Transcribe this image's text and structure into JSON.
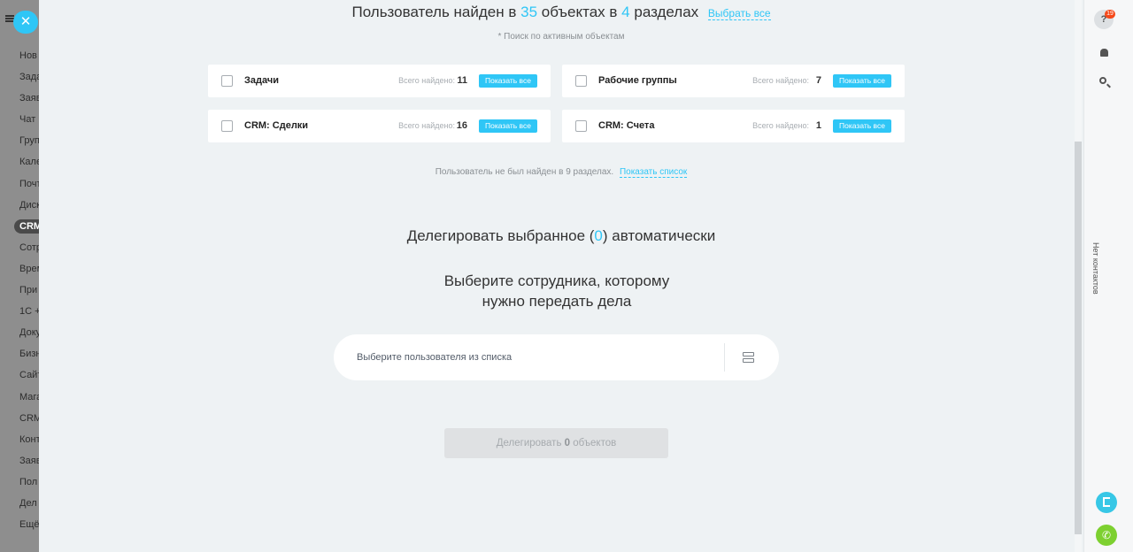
{
  "sidebar": {
    "items": [
      {
        "label": "Нов"
      },
      {
        "label": "Зада"
      },
      {
        "label": "Заяв"
      },
      {
        "label": "Чат"
      },
      {
        "label": "Груп"
      },
      {
        "label": "Кале"
      },
      {
        "label": "Почт"
      },
      {
        "label": "Диск"
      },
      {
        "label": "CRM",
        "active": true
      },
      {
        "label": "Сотр"
      },
      {
        "label": "Врем"
      },
      {
        "label": "При"
      },
      {
        "label": "1С +"
      },
      {
        "label": "Доку"
      },
      {
        "label": "Бизн"
      },
      {
        "label": "Сайт"
      },
      {
        "label": "Мага"
      },
      {
        "label": "CRM"
      },
      {
        "label": "Конт"
      },
      {
        "label": "Заяв"
      },
      {
        "label": "Пол"
      },
      {
        "label": "Дел"
      },
      {
        "label": "Ещё"
      }
    ]
  },
  "close_button": {
    "icon": "close-icon",
    "glyph": "✕"
  },
  "header": {
    "prefix": "Пользователь найден в",
    "objects_count": "35",
    "middle": "объектах в",
    "sections_count": "4",
    "suffix": "разделах",
    "select_all": "Выбрать все"
  },
  "subnote": "* Поиск по активным объектам",
  "cards": [
    {
      "name": "Задачи",
      "found_label": "Всего найдено:",
      "count": "11",
      "button": "Показать все"
    },
    {
      "name": "Рабочие группы",
      "found_label": "Всего найдено:",
      "count": "7",
      "button": "Показать все"
    },
    {
      "name": "CRM: Сделки",
      "found_label": "Всего найдено:",
      "count": "16",
      "button": "Показать все"
    },
    {
      "name": "CRM: Счета",
      "found_label": "Всего найдено:",
      "count": "1",
      "button": "Показать все"
    }
  ],
  "not_found": {
    "text": "Пользователь не был найден в 9 разделах.",
    "link": "Показать список"
  },
  "delegate_selected": {
    "prefix": "Делегировать выбранное (",
    "count": "0",
    "suffix": ") автоматически"
  },
  "choose_employee": {
    "line1": "Выберите сотрудника, которому",
    "line2": "нужно передать дела"
  },
  "user_select": {
    "placeholder": "Выберите пользователя из списка"
  },
  "delegate_button": {
    "prefix": "Делегировать",
    "count": "0",
    "suffix": "объектов"
  },
  "right_sidebar": {
    "help_badge": "19",
    "help_glyph": "?",
    "phone_glyph": "✆",
    "no_contacts": "Нет контактов"
  },
  "colors": {
    "accent": "#2fc6f6",
    "badge": "#f54819",
    "phone": "#7dd030"
  }
}
